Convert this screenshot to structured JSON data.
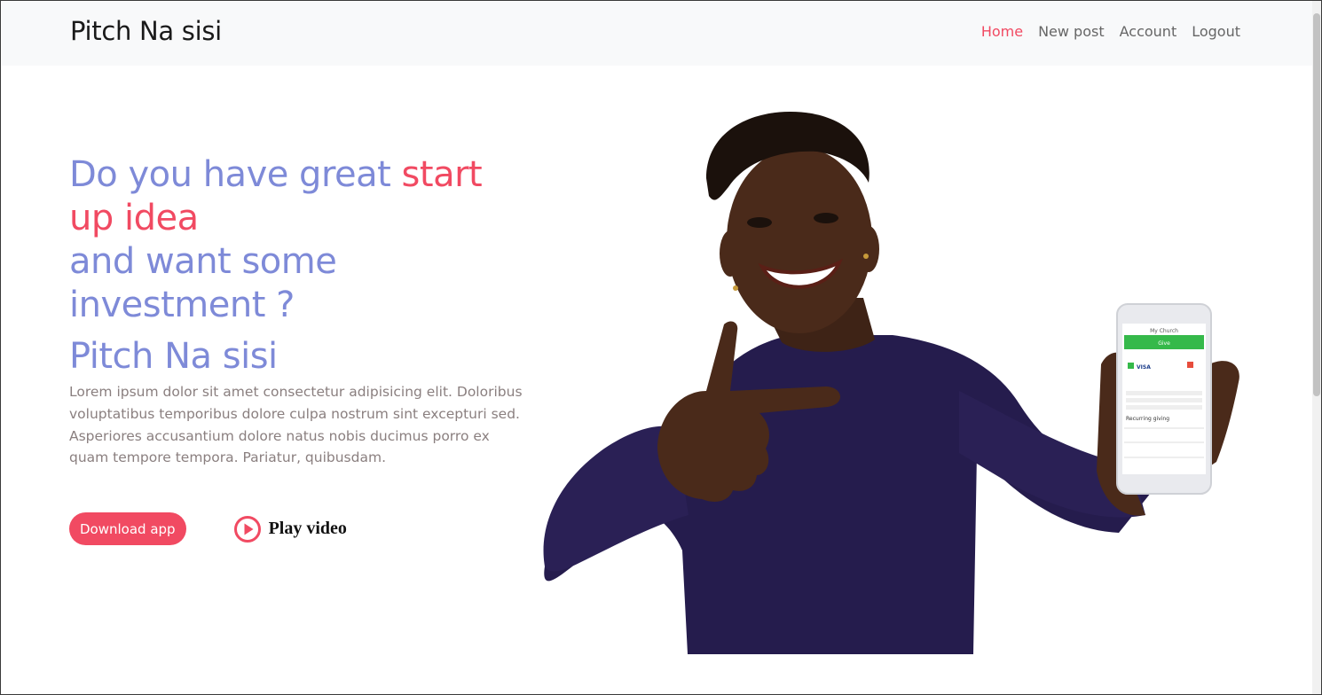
{
  "nav": {
    "brand": "Pitch Na sisi",
    "links": [
      {
        "label": "Home",
        "active": true
      },
      {
        "label": "New post",
        "active": false
      },
      {
        "label": "Account",
        "active": false
      },
      {
        "label": "Logout",
        "active": false
      }
    ]
  },
  "hero": {
    "headline_part1": "Do you have great ",
    "headline_accent": "start up idea",
    "headline_part2": "and want some investment ?",
    "subtitle": "Pitch Na sisi",
    "lead": "Lorem ipsum dolor sit amet consectetur adipisicing elit. Doloribus voluptatibus temporibus dolore culpa nostrum sint excepturi sed. Asperiores accusantium dolore natus nobis ducimus porro ex quam tempore tempora. Pariatur, quibusdam.",
    "download_label": "Download app",
    "play_label": "Play video",
    "play_icon": "play-circle-icon"
  },
  "phone_screen": {
    "title": "My Church",
    "button": "Give",
    "card": "VISA",
    "section": "Recurring giving"
  },
  "colors": {
    "accent": "#f14a62",
    "headline": "#7e8ad8",
    "body_text": "#8a7f7f",
    "navbar_bg": "#f8f9fa",
    "sweater": "#251c4d",
    "skin": "#4a2a1a"
  }
}
